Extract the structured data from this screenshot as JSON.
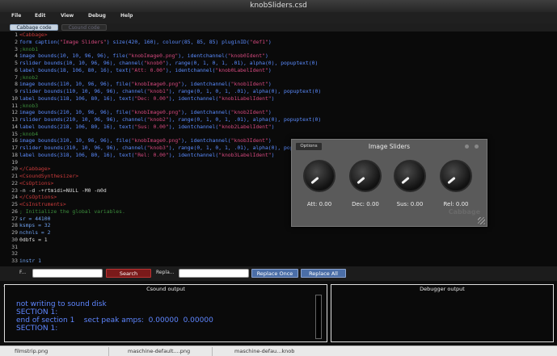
{
  "window": {
    "title": "knobSliders.csd"
  },
  "menu": [
    "File",
    "Edit",
    "View",
    "Debug",
    "Help"
  ],
  "tabs": [
    "Cabbage code",
    "Csound code"
  ],
  "code": [
    {
      "n": "1",
      "parts": [
        [
          "<Cabbage>",
          "r"
        ]
      ]
    },
    {
      "n": "2",
      "parts": [
        [
          "form caption(",
          "k"
        ],
        [
          "\"Image Sliders\"",
          "s"
        ],
        [
          ") size(420, 160), colour(85, 85, 85) pluginID(",
          "k"
        ],
        [
          "\"def1\"",
          "s"
        ],
        [
          ")",
          "k"
        ]
      ]
    },
    {
      "n": "3",
      "parts": [
        [
          ";knob1",
          "c"
        ]
      ]
    },
    {
      "n": "4",
      "parts": [
        [
          "image bounds(10, 10, 96, 96), file(",
          "k"
        ],
        [
          "\"knobImage0.png\"",
          "s"
        ],
        [
          "), identchannel(",
          "k"
        ],
        [
          "\"knob0Ident\"",
          "s"
        ],
        [
          ")",
          "k"
        ]
      ]
    },
    {
      "n": "5",
      "parts": [
        [
          "rslider bounds(10, 10, 96, 96), channel(",
          "k"
        ],
        [
          "\"knob0\"",
          "s"
        ],
        [
          "), range(0, 1, 0, 1, .01), alpha(0), popuptext(0)",
          "k"
        ]
      ]
    },
    {
      "n": "6",
      "parts": [
        [
          "label bounds(18, 106, 80, 16), text(",
          "k"
        ],
        [
          "\"Att: 0.00\"",
          "s"
        ],
        [
          "), identchannel(",
          "k"
        ],
        [
          "\"knob0LabelIdent\"",
          "s"
        ],
        [
          ")",
          "k"
        ]
      ]
    },
    {
      "n": "7",
      "parts": [
        [
          ";knob2",
          "c"
        ]
      ]
    },
    {
      "n": "8",
      "parts": [
        [
          "image bounds(110, 10, 96, 96), file(",
          "k"
        ],
        [
          "\"knobImage0.png\"",
          "s"
        ],
        [
          "), identchannel(",
          "k"
        ],
        [
          "\"knob1Ident\"",
          "s"
        ],
        [
          ")",
          "k"
        ]
      ]
    },
    {
      "n": "9",
      "parts": [
        [
          "rslider bounds(110, 10, 96, 96), channel(",
          "k"
        ],
        [
          "\"knob1\"",
          "s"
        ],
        [
          "), range(0, 1, 0, 1, .01), alpha(0), popuptext(0)",
          "k"
        ]
      ]
    },
    {
      "n": "10",
      "parts": [
        [
          "label bounds(118, 106, 80, 16), text(",
          "k"
        ],
        [
          "\"Dec: 0.00\"",
          "s"
        ],
        [
          "), identchannel(",
          "k"
        ],
        [
          "\"knob1LabelIdent\"",
          "s"
        ],
        [
          ")",
          "k"
        ]
      ]
    },
    {
      "n": "11",
      "parts": [
        [
          ";knob3",
          "c"
        ]
      ]
    },
    {
      "n": "12",
      "parts": [
        [
          "image bounds(210, 10, 96, 96), file(",
          "k"
        ],
        [
          "\"knobImage0.png\"",
          "s"
        ],
        [
          "), identchannel(",
          "k"
        ],
        [
          "\"knob2Ident\"",
          "s"
        ],
        [
          ")",
          "k"
        ]
      ]
    },
    {
      "n": "13",
      "parts": [
        [
          "rslider bounds(210, 10, 96, 96), channel(",
          "k"
        ],
        [
          "\"knob2\"",
          "s"
        ],
        [
          "), range(0, 1, 0, 1, .01), alpha(0), popuptext(0)",
          "k"
        ]
      ]
    },
    {
      "n": "14",
      "parts": [
        [
          "label bounds(218, 106, 80, 16), text(",
          "k"
        ],
        [
          "\"Sus: 0.00\"",
          "s"
        ],
        [
          "), identchannel(",
          "k"
        ],
        [
          "\"knob2LabelIdent\"",
          "s"
        ],
        [
          ")",
          "k"
        ]
      ]
    },
    {
      "n": "15",
      "parts": [
        [
          ";knob4",
          "c"
        ]
      ]
    },
    {
      "n": "16",
      "parts": [
        [
          "image bounds(310, 10, 96, 96), file(",
          "k"
        ],
        [
          "\"knobImage0.png\"",
          "s"
        ],
        [
          "), identchannel(",
          "k"
        ],
        [
          "\"knob3Ident\"",
          "s"
        ],
        [
          ")",
          "k"
        ]
      ]
    },
    {
      "n": "17",
      "parts": [
        [
          "rslider bounds(310, 10, 96, 96), channel(",
          "k"
        ],
        [
          "\"knob3\"",
          "s"
        ],
        [
          "), range(0, 1, 0, 1, .01), alpha(0), popuptext(0)",
          "k"
        ]
      ]
    },
    {
      "n": "18",
      "parts": [
        [
          "label bounds(318, 106, 80, 16), text(",
          "k"
        ],
        [
          "\"Rel: 0.00\"",
          "s"
        ],
        [
          "), identchannel(",
          "k"
        ],
        [
          "\"knob3LabelIdent\"",
          "s"
        ],
        [
          ")",
          "k"
        ]
      ]
    },
    {
      "n": "19",
      "parts": []
    },
    {
      "n": "20",
      "parts": [
        [
          "</Cabbage>",
          "r"
        ]
      ]
    },
    {
      "n": "21",
      "parts": [
        [
          "<CsoundSynthesizer>",
          "r"
        ]
      ]
    },
    {
      "n": "22",
      "parts": [
        [
          "<CsOptions>",
          "r"
        ]
      ]
    },
    {
      "n": "23",
      "parts": [
        [
          "-n -d -+rtmidi=NULL -M0 -m0d",
          "w"
        ]
      ]
    },
    {
      "n": "24",
      "parts": [
        [
          "</CsOptions>",
          "r"
        ]
      ]
    },
    {
      "n": "25",
      "parts": [
        [
          "<CsInstruments>",
          "r"
        ]
      ]
    },
    {
      "n": "26",
      "parts": [
        [
          "; Initialize the global variables.",
          "c"
        ]
      ]
    },
    {
      "n": "27",
      "parts": [
        [
          "sr = 44100",
          "l"
        ]
      ]
    },
    {
      "n": "28",
      "parts": [
        [
          "ksmps = 32",
          "l"
        ]
      ]
    },
    {
      "n": "29",
      "parts": [
        [
          "nchnls = 2",
          "l"
        ]
      ]
    },
    {
      "n": "30",
      "parts": [
        [
          "0dbfs = 1",
          "w"
        ]
      ]
    },
    {
      "n": "31",
      "parts": []
    },
    {
      "n": "32",
      "parts": []
    },
    {
      "n": "33",
      "parts": [
        [
          "instr 1",
          "l"
        ]
      ]
    }
  ],
  "plugin": {
    "title": "Image Sliders",
    "options_label": "Options",
    "logo": "Cabbage",
    "knobs": [
      {
        "label": "Att: 0.00",
        "value": 0
      },
      {
        "label": "Dec: 0.00",
        "value": 0
      },
      {
        "label": "Sus: 0.00",
        "value": 0
      },
      {
        "label": "Rel: 0.00",
        "value": 0
      }
    ]
  },
  "findbar": {
    "find_label": "F...",
    "find_value": "",
    "search_label": "Search",
    "replace_label": "Repla...",
    "replace_value": "",
    "replace_once_label": "Replace Once",
    "replace_all_label": "Replace All"
  },
  "csound_output": {
    "title": "Csound output",
    "lines": [
      "not writing to sound disk",
      "SECTION 1:",
      "end of section 1    sect peak amps:  0.00000  0.00000",
      "SECTION 1:"
    ]
  },
  "debugger_output": {
    "title": "Debugger output"
  },
  "taskbar": [
    "filmstrip.png",
    "maschine-default....png",
    "maschine-defau...knob"
  ],
  "colors": {
    "keyword": "#5b8cff",
    "string": "#d3487d",
    "tag": "#c83a3a",
    "comment": "#3c8c3c",
    "console": "#5e86ff"
  }
}
